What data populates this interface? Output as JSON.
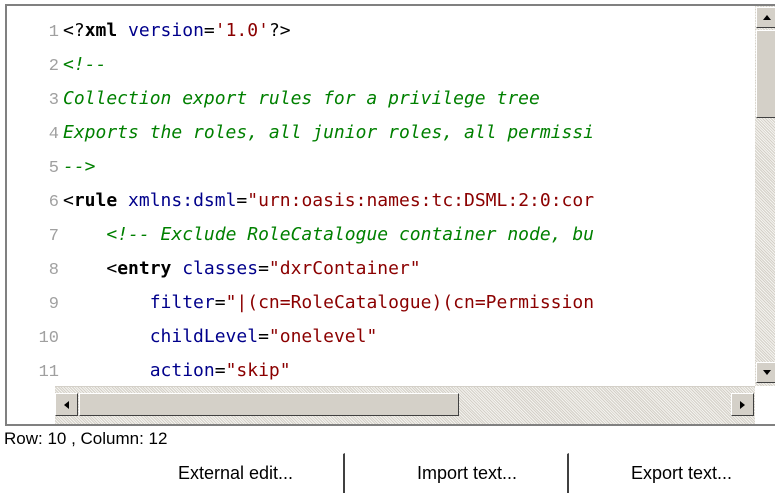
{
  "editor": {
    "lines": [
      {
        "num": "1",
        "parts": [
          [
            "punc",
            "<?"
          ],
          [
            "bold",
            "xml"
          ],
          [
            "punc",
            " "
          ],
          [
            "attr",
            "version"
          ],
          [
            "punc",
            "="
          ],
          [
            "str",
            "'1.0'"
          ],
          [
            "punc",
            "?>"
          ]
        ]
      },
      {
        "num": "2",
        "parts": [
          [
            "cmt",
            "<!--"
          ]
        ]
      },
      {
        "num": "3",
        "parts": [
          [
            "cmt",
            "Collection export rules for a privilege tree"
          ]
        ]
      },
      {
        "num": "4",
        "parts": [
          [
            "cmt",
            "Exports the roles, all junior roles, all permissi"
          ]
        ]
      },
      {
        "num": "5",
        "parts": [
          [
            "cmt",
            "-->"
          ]
        ]
      },
      {
        "num": "6",
        "parts": [
          [
            "punc",
            "<"
          ],
          [
            "bold",
            "rule"
          ],
          [
            "punc",
            " "
          ],
          [
            "attr",
            "xmlns:dsml"
          ],
          [
            "punc",
            "="
          ],
          [
            "str",
            "\"urn:oasis:names:tc:DSML:2:0:cor"
          ]
        ]
      },
      {
        "num": "7",
        "parts": [
          [
            "punc",
            "    "
          ],
          [
            "cmt",
            "<!-- Exclude RoleCatalogue container node, bu"
          ]
        ]
      },
      {
        "num": "8",
        "parts": [
          [
            "punc",
            "    <"
          ],
          [
            "bold",
            "entry"
          ],
          [
            "punc",
            " "
          ],
          [
            "attr",
            "classes"
          ],
          [
            "punc",
            "="
          ],
          [
            "str",
            "\"dxrContainer\""
          ]
        ]
      },
      {
        "num": "9",
        "parts": [
          [
            "punc",
            "        "
          ],
          [
            "attr",
            "filter"
          ],
          [
            "punc",
            "="
          ],
          [
            "str",
            "\"|(cn=RoleCatalogue)(cn=Permission"
          ]
        ]
      },
      {
        "num": "10",
        "parts": [
          [
            "punc",
            "        "
          ],
          [
            "attr",
            "childLevel"
          ],
          [
            "punc",
            "="
          ],
          [
            "str",
            "\"onelevel\""
          ]
        ]
      },
      {
        "num": "11",
        "parts": [
          [
            "punc",
            "        "
          ],
          [
            "attr",
            "action"
          ],
          [
            "punc",
            "="
          ],
          [
            "str",
            "\"skip\""
          ]
        ]
      }
    ]
  },
  "status": {
    "text": "Row: 10 , Column: 12"
  },
  "buttons": {
    "external_edit": "External edit...",
    "import_text": "Import text...",
    "export_text": "Export text..."
  },
  "icons": {
    "scroll_up": "up-arrow-icon",
    "scroll_down": "down-arrow-icon",
    "scroll_left": "left-arrow-icon",
    "scroll_right": "right-arrow-icon"
  }
}
